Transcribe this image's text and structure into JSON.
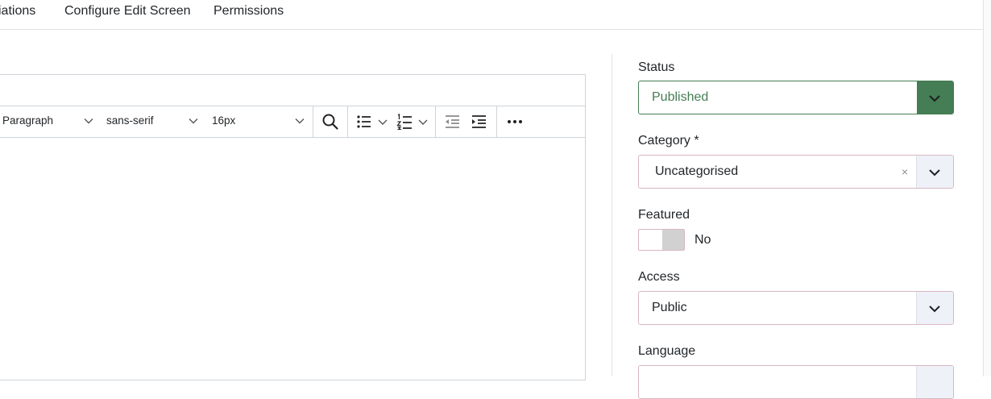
{
  "tabs": {
    "variations": "iations",
    "configure": "Configure Edit Screen",
    "permissions": "Permissions"
  },
  "editor": {
    "block_format": "Paragraph",
    "font_family": "sans-serif",
    "font_size": "16px",
    "icons": [
      "search-icon",
      "bullet-list-icon",
      "numbered-list-icon",
      "outdent-icon",
      "indent-icon",
      "more-icon"
    ]
  },
  "sidebar": {
    "status": {
      "label": "Status",
      "value": "Published",
      "accent": "#457d54"
    },
    "category": {
      "label": "Category *",
      "value": "Uncategorised",
      "clear": "×"
    },
    "featured": {
      "label": "Featured",
      "state": "No"
    },
    "access": {
      "label": "Access",
      "value": "Public"
    },
    "language": {
      "label": "Language"
    }
  },
  "colors": {
    "success": "#457d54",
    "input_border": "#d9b6bf",
    "select_button_bg": "#eef2f8"
  }
}
